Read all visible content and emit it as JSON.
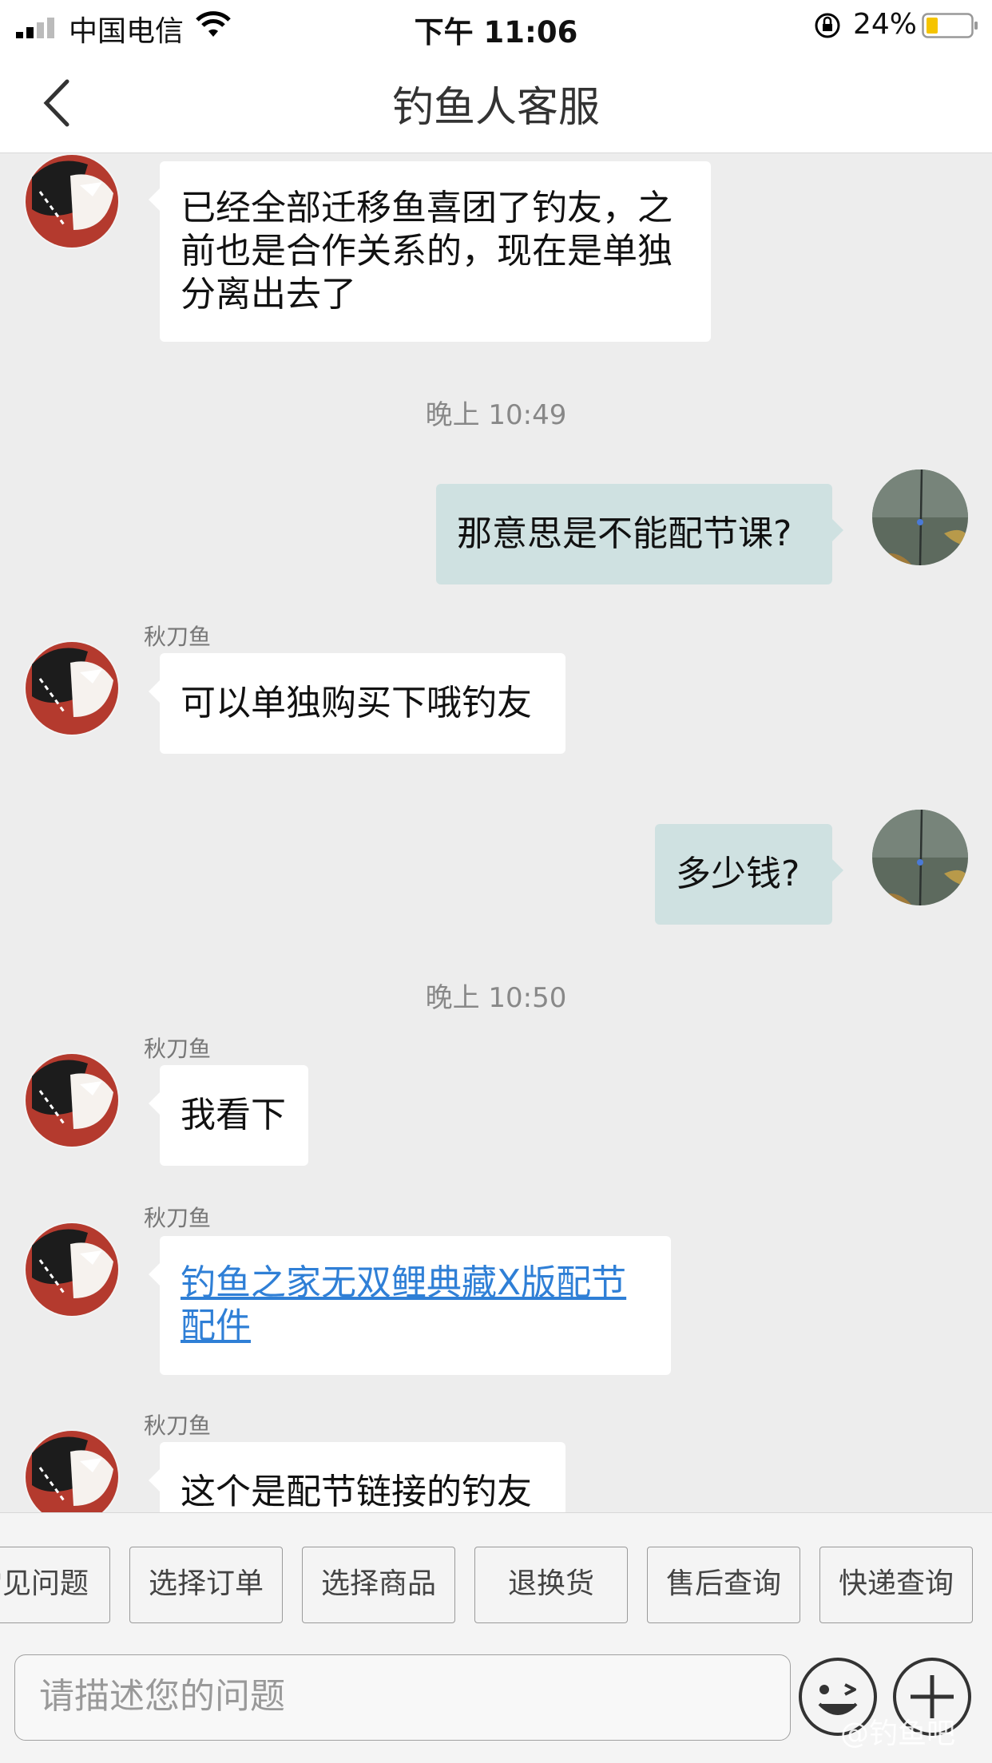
{
  "status_bar": {
    "carrier": "中国电信",
    "time": "下午 11:06",
    "battery": "24%"
  },
  "nav": {
    "title": "钓鱼人客服"
  },
  "messages": [
    {
      "lines": [
        "已经全部迁移鱼喜团了钓友，之",
        "前也是合作关系的，现在是单独",
        "分离出去了"
      ]
    },
    {
      "timestamp": "晚上 10:49"
    },
    {
      "text": "那意思是不能配节课?"
    },
    {
      "sender": "秋刀鱼",
      "text": "可以单独购买下哦钓友"
    },
    {
      "text": "多少钱?"
    },
    {
      "timestamp": "晚上 10:50"
    },
    {
      "sender": "秋刀鱼",
      "text": "我看下"
    },
    {
      "sender": "秋刀鱼",
      "lines": [
        "钓鱼之家无双鲤典藏Ⅹ版配节",
        "配件"
      ]
    },
    {
      "sender": "秋刀鱼",
      "text": "这个是配节链接的钓友"
    }
  ],
  "quick_actions": [
    "常见问题",
    "选择订单",
    "选择商品",
    "退换货",
    "售后查询",
    "快递查询"
  ],
  "input": {
    "placeholder": "请描述您的问题"
  },
  "watermark": "@钓鱼吧",
  "colors": {
    "background": "#ededed",
    "incoming_bubble": "#ffffff",
    "outgoing_bubble": "#cfe1e1",
    "link": "#2f7fd6"
  }
}
